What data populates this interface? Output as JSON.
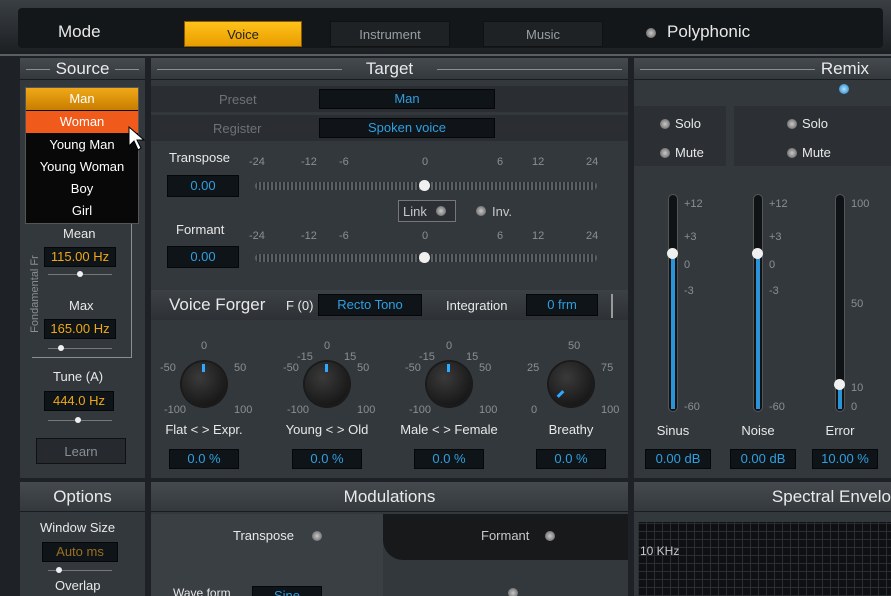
{
  "top_bar": {
    "mode_label": "Mode",
    "modes": [
      "Voice",
      "Instrument",
      "Music"
    ],
    "polyphonic_label": "Polyphonic"
  },
  "source": {
    "title": "Source",
    "dropdown_options": [
      "Man",
      "Woman",
      "Young Man",
      "Young Woman",
      "Boy",
      "Girl"
    ],
    "selected_option": "Man",
    "highlighted_option": "Woman",
    "vertical_caption": "Fondamental Fr",
    "mean_label": "Mean",
    "mean_value": "115.00 Hz",
    "max_label": "Max",
    "max_value": "165.00 Hz",
    "tune_label": "Tune (A)",
    "tune_value": "444.0 Hz",
    "learn_label": "Learn"
  },
  "target": {
    "title": "Target",
    "preset_label": "Preset",
    "preset_value": "Man",
    "register_label": "Register",
    "register_value": "Spoken voice",
    "transpose_label": "Transpose",
    "transpose_value": "0.00",
    "formant_label": "Formant",
    "formant_value": "0.00",
    "scale_labels": [
      "-24",
      "-12",
      "-6",
      "0",
      "6",
      "12",
      "24"
    ],
    "link_label": "Link",
    "inv_label": "Inv."
  },
  "voice_forger": {
    "title": "Voice Forger",
    "f_label": "F (0)",
    "f_value": "Recto Tono",
    "integration_label": "Integration",
    "integration_value": "0 frm",
    "knobs": [
      {
        "label": "Flat < > Expr.",
        "value": "0.0 %",
        "top": "0",
        "left": "-50",
        "right": "50",
        "bl": "-100",
        "br": "100"
      },
      {
        "label": "Young < > Old",
        "value": "0.0 %",
        "top": "0",
        "tl": "-15",
        "tr": "15",
        "left": "-50",
        "right": "50",
        "bl": "-100",
        "br": "100"
      },
      {
        "label": "Male < > Female",
        "value": "0.0 %",
        "top": "0",
        "tl": "-15",
        "tr": "15",
        "left": "-50",
        "right": "50",
        "bl": "-100",
        "br": "100"
      },
      {
        "label": "Breathy",
        "value": "0.0 %",
        "top": "50",
        "left": "25",
        "right": "75",
        "bl": "0",
        "br": "100"
      }
    ]
  },
  "remix": {
    "title": "Remix",
    "solo_label": "Solo",
    "mute_label": "Mute",
    "scale": [
      "+12",
      "+3",
      "0",
      "-3",
      "-60"
    ],
    "scale2": [
      "100",
      "50",
      "10",
      "0"
    ],
    "channels": [
      {
        "name": "Sinus",
        "value": "0.00 dB",
        "level": 0.73
      },
      {
        "name": "Noise",
        "value": "0.00 dB",
        "level": 0.73
      },
      {
        "name": "Error",
        "value": "10.00 %",
        "level": 0.13
      }
    ]
  },
  "options": {
    "title": "Options",
    "window_size_label": "Window Size",
    "window_size_value": "Auto ms",
    "overlap_label": "Overlap"
  },
  "modulations": {
    "title": "Modulations",
    "tabs": [
      "Transpose",
      "Formant"
    ],
    "waveform_label": "Wave form",
    "waveform_value": "Sine"
  },
  "spectral": {
    "title": "Spectral Envelo",
    "freq_label": "10 KHz"
  }
}
